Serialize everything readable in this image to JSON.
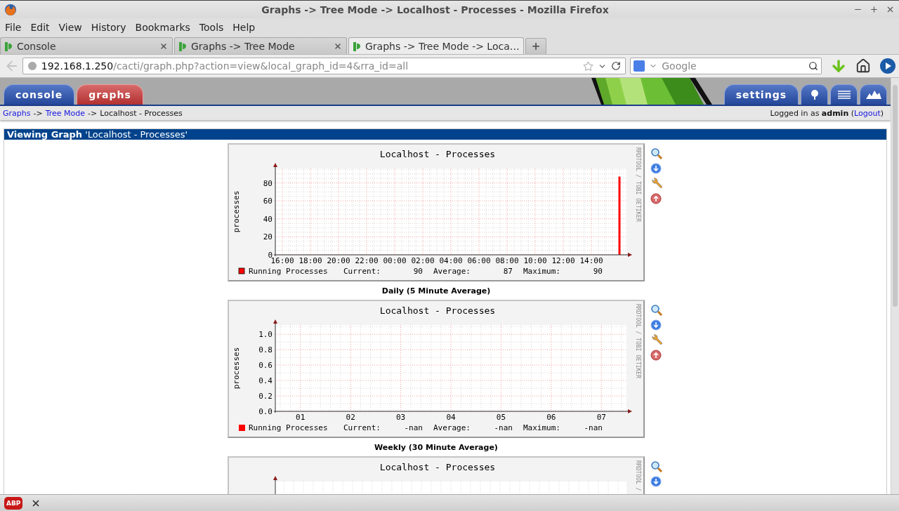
{
  "window": {
    "title": "Graphs -> Tree Mode -> Localhost - Processes - Mozilla Firefox"
  },
  "menu": [
    "File",
    "Edit",
    "View",
    "History",
    "Bookmarks",
    "Tools",
    "Help"
  ],
  "tabs": [
    {
      "label": "Console",
      "selected": false
    },
    {
      "label": "Graphs -> Tree Mode",
      "selected": false
    },
    {
      "label": "Graphs -> Tree Mode -> Loca…",
      "selected": true
    }
  ],
  "new_tab": "+",
  "address": {
    "host": "192.168.1.250",
    "path": "/cacti/graph.php?action=view&local_graph_id=4&rra_id=all"
  },
  "search": {
    "placeholder": "Google"
  },
  "cacti_tabs": [
    {
      "label": "console",
      "selected": false
    },
    {
      "label": "graphs",
      "selected": true
    }
  ],
  "settings_tab": "settings",
  "breadcrumb": [
    {
      "kind": "link",
      "text": "Graphs"
    },
    {
      "kind": "sep",
      "text": "->"
    },
    {
      "kind": "link",
      "text": "Tree Mode"
    },
    {
      "kind": "sep",
      "text": "->"
    },
    {
      "kind": "current",
      "text": "Localhost - Processes"
    }
  ],
  "login": {
    "text": "Logged in as **admin** (",
    "link": "Logout",
    "after": ")"
  },
  "viewing": "**Viewing Graph** 'Localhost - Processes'",
  "graphs": [
    {
      "credit": "RRDTOOL / TOBI OETIKER",
      "caption": "Daily (5 Minute Average)",
      "legend": {
        "stats": [
          {
            "label": "Current:",
            "value": "90"
          },
          {
            "label": "Average:",
            "value": "87"
          },
          {
            "label": "Maximum:",
            "value": "90"
          }
        ]
      },
      "chart_data": {
        "type": "bar",
        "title": "Localhost - Processes",
        "ylabel": "processes",
        "grid": true,
        "ylim": [
          0,
          96
        ],
        "categories": [
          "16:00",
          null,
          "18:00",
          null,
          "20:00",
          null,
          "22:00",
          null,
          "00:00",
          null,
          "02:00",
          null,
          "04:00",
          null,
          "06:00",
          null,
          "08:00",
          null,
          "10:00",
          null,
          "12:00",
          null,
          "14:00",
          null,
          null
        ],
        "yticks": [
          0,
          20,
          40,
          60,
          80
        ],
        "series": [
          {
            "name": "Running Processes",
            "color": "#ff0000",
            "values": [
              null,
              null,
              null,
              null,
              null,
              null,
              null,
              null,
              null,
              null,
              null,
              null,
              null,
              null,
              null,
              null,
              null,
              null,
              null,
              null,
              null,
              null,
              null,
              null,
              87
            ]
          }
        ]
      }
    },
    {
      "credit": "RRDTOOL / TOBI OETIKER",
      "caption": "Weekly (30 Minute Average)",
      "legend": {
        "stats": [
          {
            "label": "Current:",
            "value": "-nan"
          },
          {
            "label": "Average:",
            "value": "-nan"
          },
          {
            "label": "Maximum:",
            "value": "-nan"
          }
        ]
      },
      "chart_data": {
        "type": "area",
        "title": "Localhost - Processes",
        "ylabel": "processes",
        "grid": true,
        "ylim": [
          0,
          1.12
        ],
        "categories": [
          "01",
          "02",
          "03",
          "04",
          "05",
          "06",
          "07"
        ],
        "yticks": [
          {
            "value": 0,
            "label": "0.0"
          },
          {
            "value": 0.2,
            "label": "0.2"
          },
          {
            "value": 0.4,
            "label": "0.4"
          },
          {
            "value": 0.6,
            "label": "0.6"
          },
          {
            "value": 0.8,
            "label": "0.8"
          },
          {
            "value": 1,
            "label": "1.0"
          }
        ],
        "series": [
          {
            "name": "Running Processes",
            "color": "#ff0000",
            "values": [
              null,
              null,
              null,
              null,
              null,
              null,
              null
            ]
          }
        ]
      }
    },
    {
      "title": "Localhost - Processes",
      "credit": "RRDTOOL /"
    }
  ],
  "status_bar": {
    "addon_badge": "ABP"
  }
}
